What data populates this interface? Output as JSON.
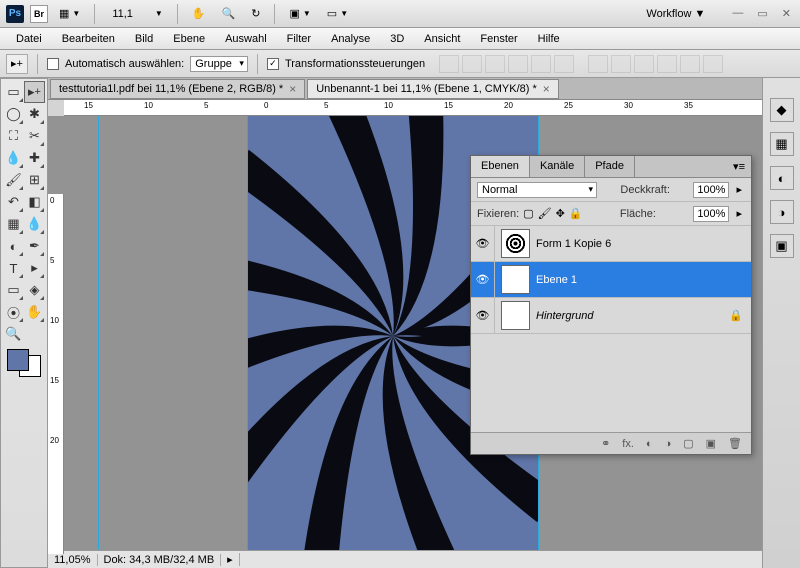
{
  "titlebar": {
    "zoom": "11,1",
    "workflow": "Workflow"
  },
  "menus": [
    "Datei",
    "Bearbeiten",
    "Bild",
    "Ebene",
    "Auswahl",
    "Filter",
    "Analyse",
    "3D",
    "Ansicht",
    "Fenster",
    "Hilfe"
  ],
  "options": {
    "auto_select": "Automatisch auswählen:",
    "group": "Gruppe",
    "transform": "Transformationssteuerungen"
  },
  "tabs": [
    {
      "label": "testtutoria1l.pdf bei 11,1% (Ebene 2, RGB/8) *"
    },
    {
      "label": "Unbenannt-1 bei 11,1% (Ebene 1, CMYK/8) *"
    }
  ],
  "ruler_h": [
    "15",
    "10",
    "5",
    "0",
    "5",
    "10",
    "15",
    "20",
    "25",
    "30",
    "35"
  ],
  "ruler_v": [
    "0",
    "5",
    "10",
    "15",
    "20"
  ],
  "status": {
    "zoom": "11,05%",
    "doc": "Dok: 34,3 MB/32,4 MB"
  },
  "layers_panel": {
    "tabs": [
      "Ebenen",
      "Kanäle",
      "Pfade"
    ],
    "blend_mode": "Normal",
    "opacity_label": "Deckkraft:",
    "opacity_value": "100%",
    "lock_label": "Fixieren:",
    "fill_label": "Fläche:",
    "fill_value": "100%",
    "layers": [
      {
        "name": "Form 1 Kopie 6",
        "selected": false,
        "thumb": "swirl"
      },
      {
        "name": "Ebene 1",
        "selected": true,
        "thumb": "blank"
      },
      {
        "name": "Hintergrund",
        "selected": false,
        "thumb": "blank",
        "locked": true,
        "italic": true
      }
    ]
  },
  "colors": {
    "fg": "#6076a8",
    "bg": "#ffffff",
    "artboard": "#6076a8"
  }
}
